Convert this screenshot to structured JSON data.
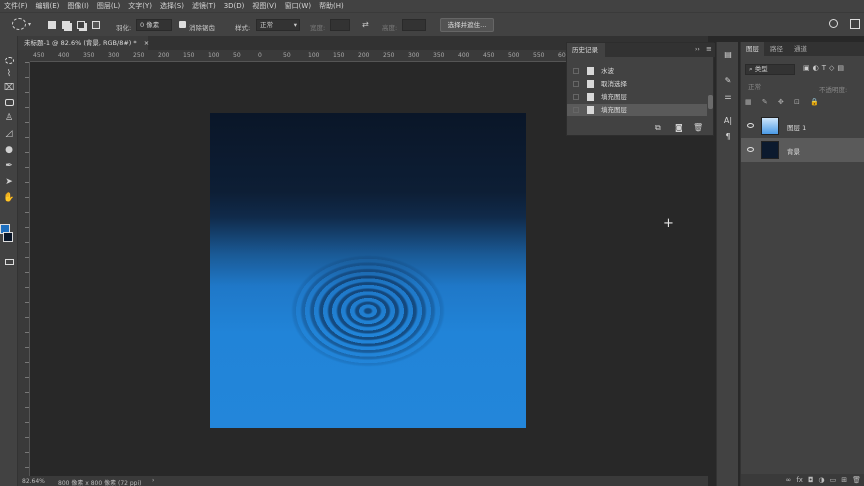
{
  "menu": [
    "文件(F)",
    "编辑(E)",
    "图像(I)",
    "图层(L)",
    "文字(Y)",
    "选择(S)",
    "滤镜(T)",
    "3D(D)",
    "视图(V)",
    "窗口(W)",
    "帮助(H)"
  ],
  "options": {
    "feather_label": "羽化:",
    "feather_value": "0 像素",
    "antialias_label": "消除锯齿",
    "style_label": "样式:",
    "style_value": "正常",
    "width_label": "宽度:",
    "height_label": "高度:",
    "select_mask_button": "选择并遮住..."
  },
  "document": {
    "tab_title": "未标题-1 @ 82.6% (背景, RGB/8#) *",
    "zoom": "82.64%",
    "size_info": "800 像素 x 800 像素 (72 ppi)"
  },
  "ruler_top_labels": [
    "450",
    "400",
    "350",
    "300",
    "250",
    "200",
    "150",
    "100",
    "50",
    "0",
    "50",
    "100",
    "150",
    "200",
    "250",
    "300",
    "350",
    "400",
    "450",
    "500",
    "550",
    "600",
    "650",
    "700",
    "750",
    "800",
    "850"
  ],
  "history": {
    "title": "历史记录",
    "items": [
      {
        "label": "水波",
        "selected": false
      },
      {
        "label": "取消选择",
        "selected": false
      },
      {
        "label": "填充图层",
        "selected": false
      },
      {
        "label": "填充图层",
        "selected": true
      }
    ]
  },
  "layers_panel": {
    "tabs": [
      "图层",
      "路径",
      "通道"
    ],
    "filter_label": "类型",
    "blend_mode": "正常",
    "opacity_label": "不透明度:",
    "layers": [
      {
        "name": "图层 1",
        "selected": false,
        "thumb_color": "#6ab0ee"
      },
      {
        "name": "背景",
        "selected": true,
        "thumb_color": "#0c1a2e"
      }
    ]
  },
  "colors": {
    "ui_dark": "#282828",
    "panel": "#424242",
    "gradient_top": "#0a1628",
    "gradient_bottom": "#2386da"
  }
}
